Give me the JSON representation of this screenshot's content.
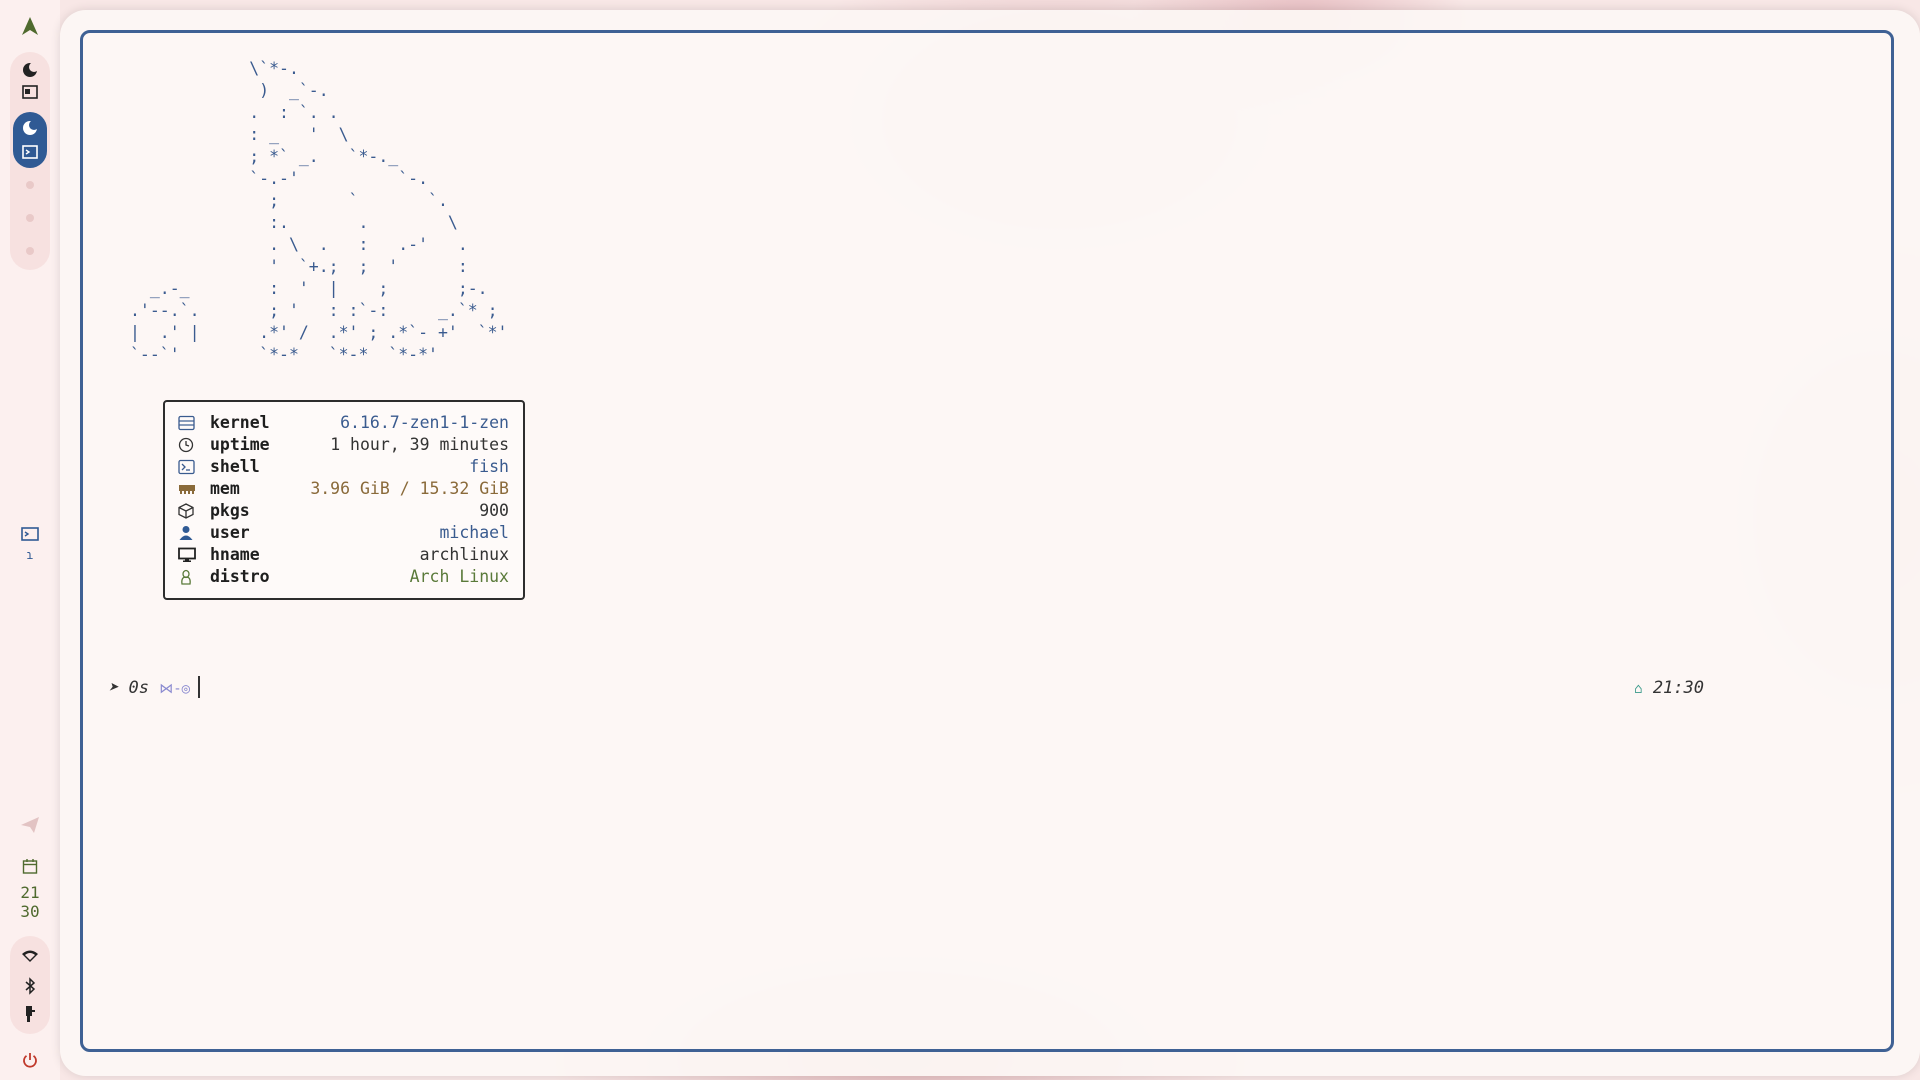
{
  "sidebar": {
    "clock_hour": "21",
    "clock_minute": "30",
    "tray_label": "ɿ"
  },
  "terminal": {
    "ascii_art": "            \\`*-.\n             )  _`-.\n            .  : `. .\n            : _   '  \\\n            ; *` _.   `*-._\n            `-.-'          `-.\n              ;       `       `.\n              :.       .        \\\n              . \\  .   :   .-'   .\n              '  `+.;  ;  '      :\n  _.-_        :  '  |    ;       ;-.\n.'--.`.       ; '   : :`-:     _.`* ;\n|  .' |      .*' /  .*' ; .*`- +'  `*'\n`--`'        `*-*   `*-*  `*-*'",
    "fetch": [
      {
        "key": "kernel",
        "value": "6.16.7-zen1-1-zen",
        "icon": "server-icon",
        "color": "#3a5b8f"
      },
      {
        "key": "uptime",
        "value": "1 hour, 39 minutes",
        "icon": "clock-icon",
        "color": "#333333"
      },
      {
        "key": "shell",
        "value": "fish",
        "icon": "terminal-icon",
        "color": "#3a5b8f"
      },
      {
        "key": "mem",
        "value": "3.96 GiB / 15.32 GiB",
        "icon": "memory-icon",
        "color": "#8a6a3a"
      },
      {
        "key": "pkgs",
        "value": "900",
        "icon": "package-icon",
        "color": "#333333"
      },
      {
        "key": "user",
        "value": "michael",
        "icon": "user-icon",
        "color": "#3a5b8f"
      },
      {
        "key": "hname",
        "value": "archlinux",
        "icon": "monitor-icon",
        "color": "#333333"
      },
      {
        "key": "distro",
        "value": "Arch Linux",
        "icon": "linux-icon",
        "color": "#5a7a3a"
      }
    ],
    "prompt_left": "➤ 0s",
    "prompt_git": "⋈-◎",
    "prompt_right_time": "21:30",
    "prompt_right_icon": "⌂"
  },
  "colors": {
    "accent": "#305a94",
    "border": "#3f6194",
    "clock": "#4f6a2e",
    "power": "#c0392b"
  }
}
